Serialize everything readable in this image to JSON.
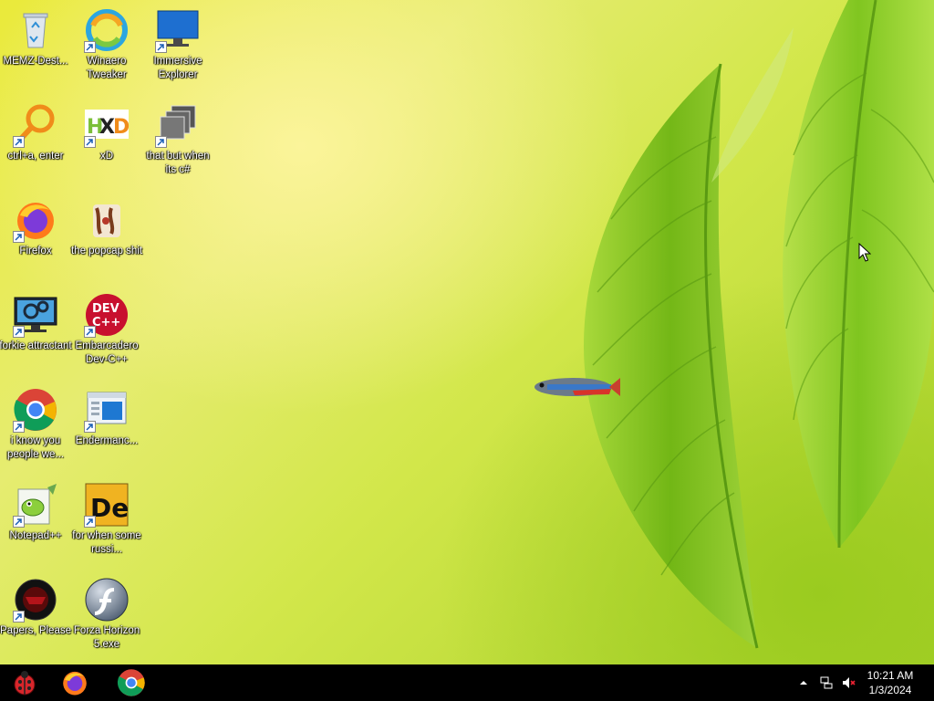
{
  "desktop": {
    "icons": [
      {
        "label": "MEMZ-Dest...",
        "icon": "recycle-bin-icon"
      },
      {
        "label": "Winaero Tweaker",
        "icon": "winaero-icon"
      },
      {
        "label": "Immersive Explorer",
        "icon": "monitor-icon"
      },
      {
        "label": "ctrl+a, enter",
        "icon": "magnifier-icon"
      },
      {
        "label": "xD",
        "icon": "hxd-icon"
      },
      {
        "label": "that but when its c#",
        "icon": "stacked-windows-icon"
      },
      {
        "label": "Firefox",
        "icon": "firefox-icon"
      },
      {
        "label": "the popcap shit",
        "icon": "popcap-icon"
      },
      {
        "label": "forkie attractant",
        "icon": "gear-monitor-icon"
      },
      {
        "label": "Embarcadero Dev-C++",
        "icon": "devcpp-icon"
      },
      {
        "label": "i know you people we...",
        "icon": "chrome-icon"
      },
      {
        "label": "Endermanc...",
        "icon": "window-app-icon"
      },
      {
        "label": "Notepad++",
        "icon": "notepadpp-icon"
      },
      {
        "label": "for when some russi...",
        "icon": "de-icon"
      },
      {
        "label": "Papers, Please",
        "icon": "papers-please-icon"
      },
      {
        "label": "Forza Horizon 5.exe",
        "icon": "flash-icon"
      }
    ]
  },
  "taskbar": {
    "apps": [
      {
        "name": "start-button",
        "icon": "ladybug-icon"
      },
      {
        "name": "firefox",
        "icon": "firefox-icon"
      },
      {
        "name": "chrome",
        "icon": "chrome-icon"
      }
    ],
    "tray": {
      "time": "10:21 AM",
      "date": "1/3/2024"
    }
  },
  "colors": {
    "taskbar": "#000000",
    "wallpaper_light": "#f3f07a",
    "wallpaper_dark": "#8cc63f",
    "leaf": "#7fc21b"
  }
}
